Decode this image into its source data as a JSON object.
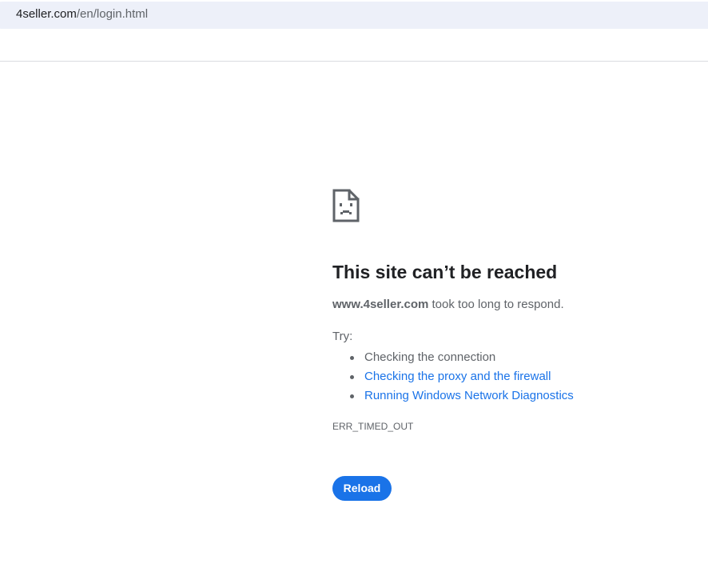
{
  "address_bar": {
    "host": "4seller.com",
    "path": "/en/login.html"
  },
  "error_page": {
    "icon": "sad-page-icon",
    "title": "This site can’t be reached",
    "summary_host": "www.4seller.com",
    "summary_rest": " took too long to respond.",
    "try_label": "Try:",
    "suggestions": [
      {
        "label": "Checking the connection",
        "link": false
      },
      {
        "label": "Checking the proxy and the firewall",
        "link": true
      },
      {
        "label": "Running Windows Network Diagnostics",
        "link": true
      }
    ],
    "error_code": "ERR_TIMED_OUT",
    "reload_label": "Reload"
  },
  "colors": {
    "accent": "#1a73e8",
    "address_bar_bg": "#edf0f9",
    "text_primary": "#202124",
    "text_secondary": "#5f6368"
  }
}
